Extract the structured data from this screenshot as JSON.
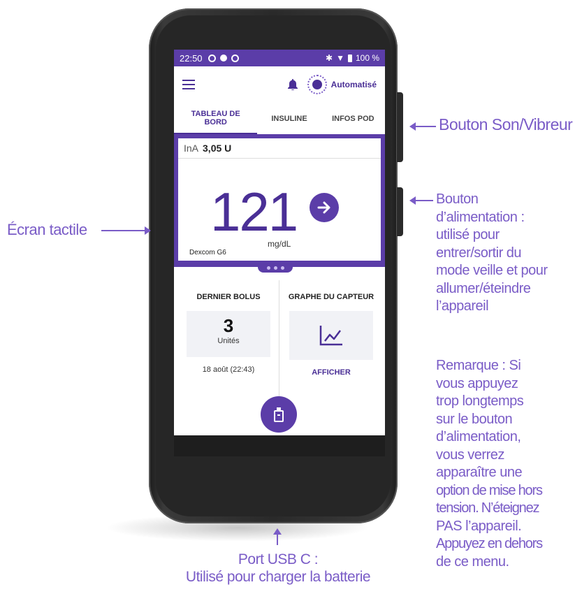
{
  "colors": {
    "accent": "#5b3da8",
    "callout": "#7a5cc7"
  },
  "status_bar": {
    "time": "22:50",
    "battery": "100 %",
    "icons": [
      "bluetooth-icon",
      "wifi-icon",
      "battery-icon"
    ]
  },
  "app_bar": {
    "menu_icon": "hamburger-icon",
    "bell_icon": "bell-icon",
    "mode_label": "Automatisé"
  },
  "tabs": [
    {
      "label": "TABLEAU DE BORD",
      "active": true
    },
    {
      "label": "INSULINE",
      "active": false
    },
    {
      "label": "INFOS POD",
      "active": false
    }
  ],
  "glucose_card": {
    "ina_label": "InA",
    "ina_value": "3,05 U",
    "value": "121",
    "unit": "mg/dL",
    "sensor": "Dexcom G6",
    "trend_icon": "arrow-right-icon"
  },
  "last_bolus": {
    "title": "DERNIER BOLUS",
    "value": "3",
    "unit": "Unités",
    "date": "18 août (22:43)"
  },
  "sensor_graph": {
    "title": "GRAPHE DU CAPTEUR",
    "icon": "graph-icon",
    "link": "AFFICHER"
  },
  "callouts": {
    "sound": "Bouton Son/Vibreur",
    "power": [
      "Bouton",
      "d’alimentation :",
      "utilisé pour",
      "entrer/sortir du",
      "mode veille et pour",
      "allumer/éteindre",
      "l’appareil"
    ],
    "note": [
      "Remarque : Si",
      "vous appuyez",
      "trop longtemps",
      "sur le bouton",
      "d’alimentation,",
      "vous verrez",
      "apparaître une",
      "option de mise hors",
      "tension. N’éteignez",
      "PAS l’appareil.",
      "Appuyez en dehors",
      "de ce menu."
    ],
    "touch": "Écran tactile",
    "usb": [
      "Port USB C :",
      "Utilisé pour charger la batterie"
    ]
  }
}
